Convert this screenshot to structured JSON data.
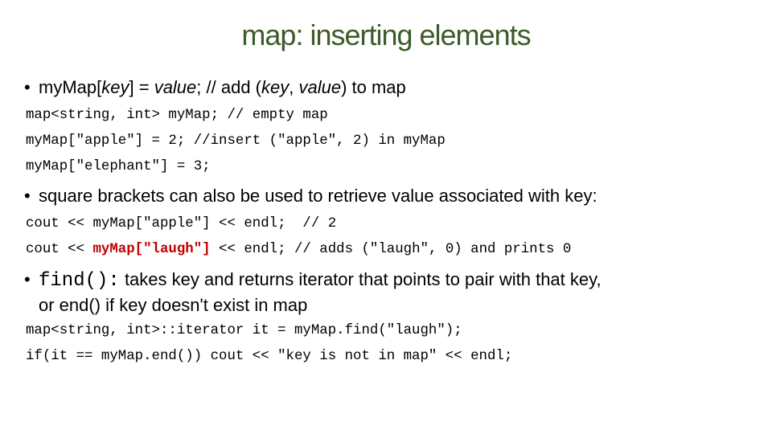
{
  "title": "map: inserting elements",
  "bullet1": {
    "p1": "myMap[",
    "key1": "key",
    "p2": "] = ",
    "value1": "value",
    "p3": "; // add (",
    "key2": "key",
    "p4": ", ",
    "value2": "value",
    "p5": ") to map"
  },
  "code1": [
    "map<string, int> myMap; // empty map",
    "myMap[\"apple\"] = 2; //insert (\"apple\", 2) in myMap",
    "myMap[\"elephant\"] = 3;"
  ],
  "bullet2": "square brackets can also be used to retrieve value associated with key:",
  "code2": {
    "line1": "cout << myMap[\"apple\"] << endl;  // 2",
    "line2_pre": "cout << ",
    "line2_highlight": "myMap[\"laugh\"]",
    "line2_post": " << endl; // adds (\"laugh\", 0) and prints 0"
  },
  "bullet3": {
    "code": "find():",
    "text1": " takes key and returns iterator that points to pair with that key,",
    "text2": "or end() if key doesn't exist in map"
  },
  "code3": [
    "map<string, int>::iterator it = myMap.find(\"laugh\");",
    "if(it == myMap.end()) cout << \"key is not in map\" << endl;"
  ],
  "colors": {
    "title": "#3c5b28",
    "highlight": "#c00000"
  }
}
